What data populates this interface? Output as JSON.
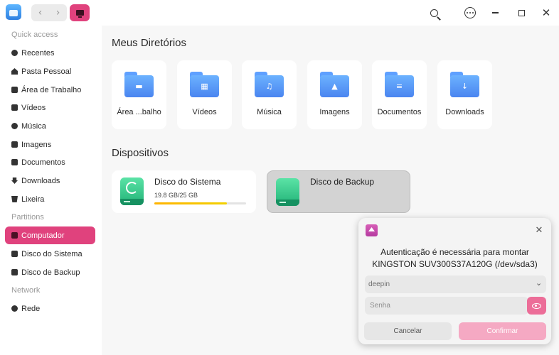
{
  "titlebar": {
    "nav_back": "‹",
    "nav_forward": "›",
    "close": "✕"
  },
  "sidebar": {
    "sections": [
      "Quick access",
      "Partitions",
      "Network"
    ],
    "items": [
      {
        "label": "Recentes",
        "icon": "clock-icon"
      },
      {
        "label": "Pasta Pessoal",
        "icon": "home-icon"
      },
      {
        "label": "Área de Trabalho",
        "icon": "desktop-icon"
      },
      {
        "label": "Vídeos",
        "icon": "video-icon"
      },
      {
        "label": "Música",
        "icon": "music-icon"
      },
      {
        "label": "Imagens",
        "icon": "image-icon"
      },
      {
        "label": "Documentos",
        "icon": "document-icon"
      },
      {
        "label": "Downloads",
        "icon": "download-icon"
      },
      {
        "label": "Lixeira",
        "icon": "trash-icon"
      },
      {
        "label": "Computador",
        "icon": "computer-icon",
        "active": true
      },
      {
        "label": "Disco do Sistema",
        "icon": "disk-icon"
      },
      {
        "label": "Disco de Backup",
        "icon": "disk-icon"
      },
      {
        "label": "Rede",
        "icon": "network-icon"
      }
    ]
  },
  "main": {
    "directories_title": "Meus Diretórios",
    "folders": [
      {
        "label": "Área ...balho",
        "glyph": "▬",
        "icon": "desktop-folder-icon"
      },
      {
        "label": "Vídeos",
        "glyph": "▦",
        "icon": "video-folder-icon"
      },
      {
        "label": "Música",
        "glyph": "♫",
        "icon": "music-folder-icon"
      },
      {
        "label": "Imagens",
        "glyph": "▲",
        "icon": "image-folder-icon"
      },
      {
        "label": "Documentos",
        "glyph": "≡",
        "icon": "document-folder-icon"
      },
      {
        "label": "Downloads",
        "glyph": "↓",
        "icon": "download-folder-icon"
      }
    ],
    "devices_title": "Dispositivos",
    "devices": [
      {
        "name": "Disco do Sistema",
        "size": "19.8 GB/25 GB",
        "usage_fraction": 0.79
      },
      {
        "name": "Disco de Backup"
      }
    ]
  },
  "dialog": {
    "close": "✕",
    "message_line1": "Autenticação é necessária para montar",
    "message_line2": "KINGSTON SUV300S37A120G (/dev/sda3)",
    "user": "deepin",
    "user_chevron": "⌄",
    "password_placeholder": "Senha",
    "cancel_label": "Cancelar",
    "confirm_label": "Confirmar"
  },
  "colors": {
    "accent": "#e0427d",
    "confirm_disabled": "#f5a9c3",
    "usage_bar": "#ffb300"
  }
}
